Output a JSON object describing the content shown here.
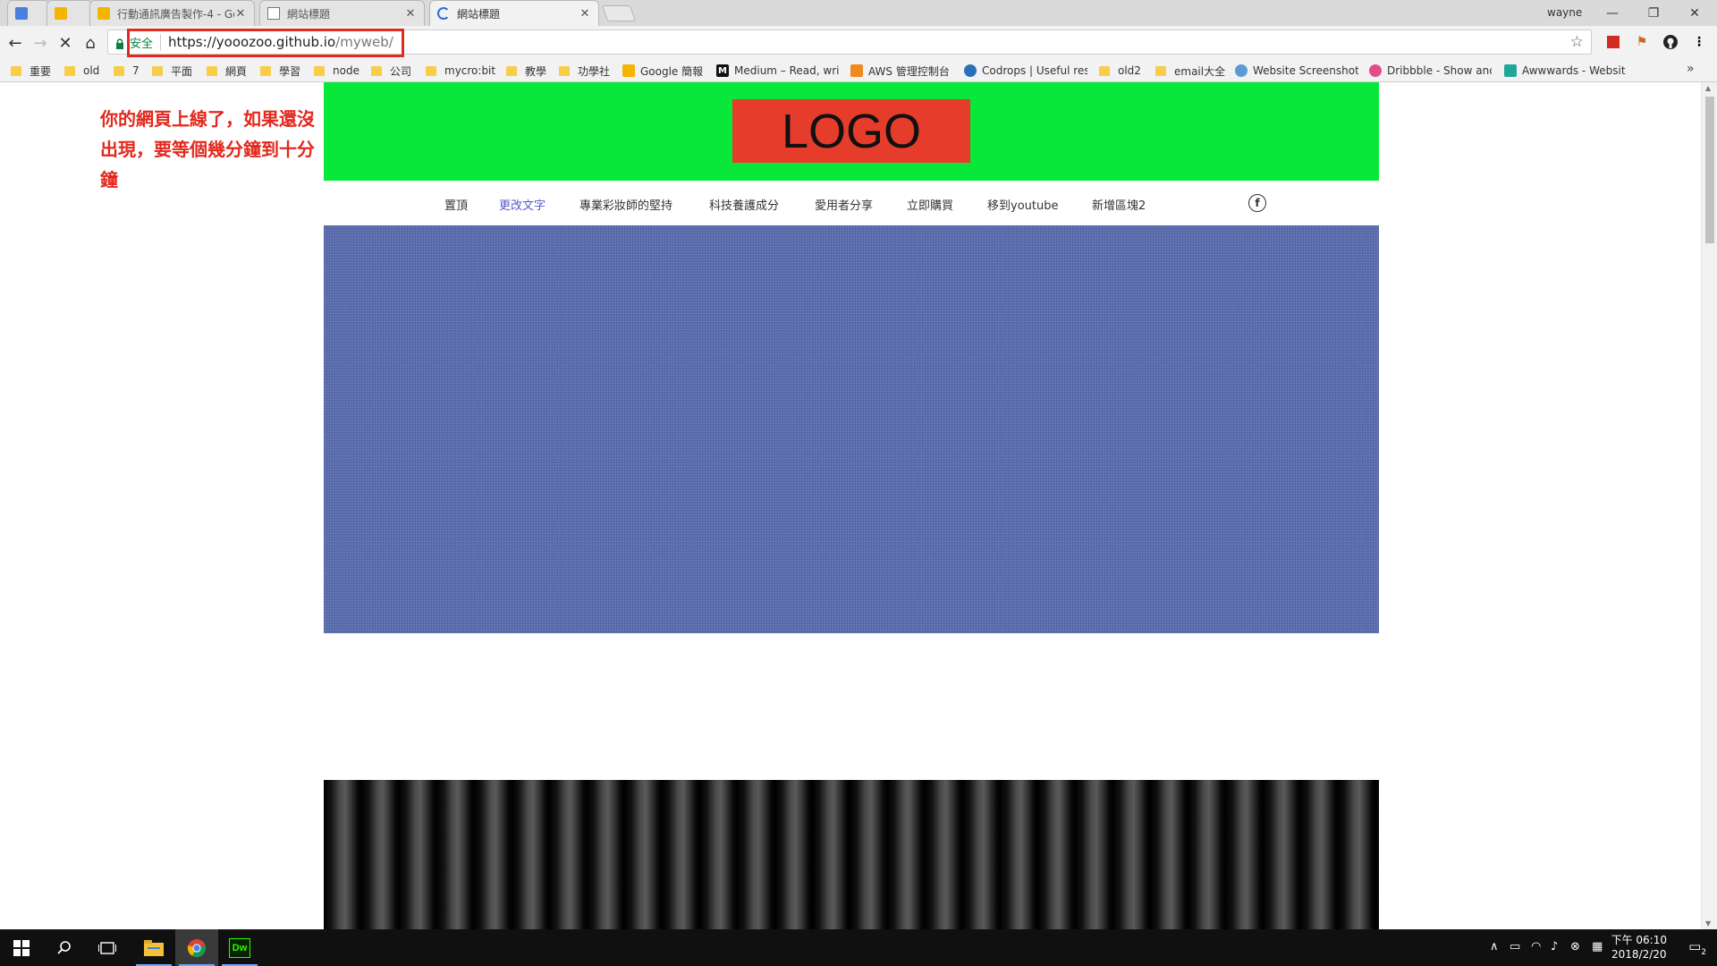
{
  "browser": {
    "tabs": [
      {
        "title": "",
        "favicon": "google-translate-icon"
      },
      {
        "title": "",
        "favicon": "slides-icon"
      },
      {
        "title": "行動通訊廣告製作-4 - Go",
        "favicon": "slides-icon"
      },
      {
        "title": "網站標題",
        "favicon": "page-icon"
      },
      {
        "title": "網站標題",
        "favicon": "loading-icon"
      }
    ],
    "user": "wayne",
    "omnibox": {
      "secure_label": "安全",
      "url_host": "https://yooozoo.github.io",
      "url_path": "/myweb/"
    },
    "bookmarks": [
      {
        "label": "重要",
        "type": "folder"
      },
      {
        "label": "old",
        "type": "folder"
      },
      {
        "label": "7",
        "type": "folder"
      },
      {
        "label": "平面",
        "type": "folder"
      },
      {
        "label": "網頁",
        "type": "folder"
      },
      {
        "label": "學習",
        "type": "folder"
      },
      {
        "label": "node",
        "type": "folder"
      },
      {
        "label": "公司",
        "type": "folder"
      },
      {
        "label": "mycro:bit",
        "type": "folder"
      },
      {
        "label": "教學",
        "type": "folder"
      },
      {
        "label": "功學社",
        "type": "folder"
      },
      {
        "label": "Google 簡報",
        "type": "site"
      },
      {
        "label": "Medium – Read, wri",
        "type": "site"
      },
      {
        "label": "AWS 管理控制台",
        "type": "site"
      },
      {
        "label": "Codrops | Useful res",
        "type": "site"
      },
      {
        "label": "old2",
        "type": "folder"
      },
      {
        "label": "email大全",
        "type": "folder"
      },
      {
        "label": "Website Screenshot",
        "type": "site"
      },
      {
        "label": "Dribbble - Show anc",
        "type": "site"
      },
      {
        "label": "Awwwards - Websit",
        "type": "site"
      }
    ]
  },
  "page": {
    "note": "你的網頁上線了，如果還沒出現，要等個幾分鐘到十分鐘",
    "logo": "LOGO",
    "nav": [
      "置頂",
      "更改文字",
      "專業彩妝師的堅持",
      "科技養護成分",
      "愛用者分享",
      "立即購買",
      "移到youtube",
      "新增區塊2"
    ],
    "colors": {
      "header": "#08e83a",
      "logo_bg": "#e63c2b",
      "hero": "#5a6fb2",
      "note": "#e3281d",
      "nav_active": "#5b57c8"
    }
  },
  "taskbar": {
    "time": "下午 06:10",
    "date": "2018/2/20",
    "notifications": "2"
  }
}
